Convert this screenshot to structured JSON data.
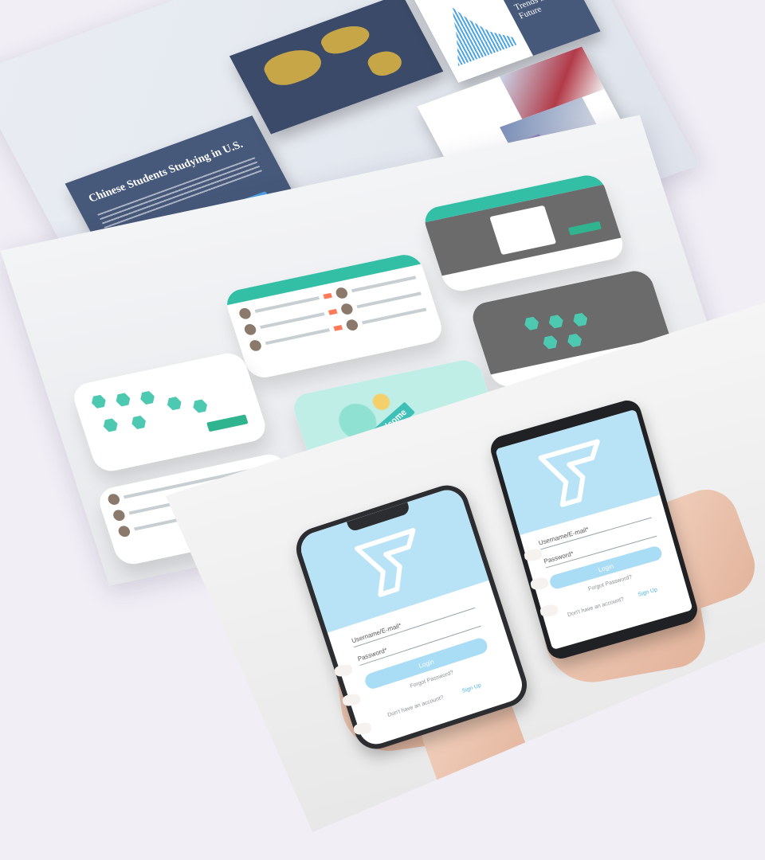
{
  "slides": {
    "title": "Chinese Students Studying in U.S.",
    "trends": "Trends in the Future",
    "accent": "#4ba3e8",
    "slide_bg": "#46597a",
    "blue_slide_bg": "#5b8dc4"
  },
  "apps": {
    "teal": "#33bfa6",
    "welcome": "Welcome"
  },
  "login_left": {
    "username_label": "Username/E-mail*",
    "password_label": "Password*",
    "login_button": "Login",
    "forgot": "Forgot Password?",
    "no_account": "Don't have an account?",
    "signup": "Sign Up"
  },
  "login_right": {
    "username_label": "Username/E-mail*",
    "password_label": "Password*",
    "login_button": "Login",
    "forgot": "Forgot Password?",
    "no_account": "Don't have an account?",
    "signup": "Sign Up"
  },
  "colors": {
    "background": "#f1eef6",
    "login_header": "#b8e3f7",
    "login_button": "#a9dcf5",
    "signup_link": "#54b4e6"
  }
}
